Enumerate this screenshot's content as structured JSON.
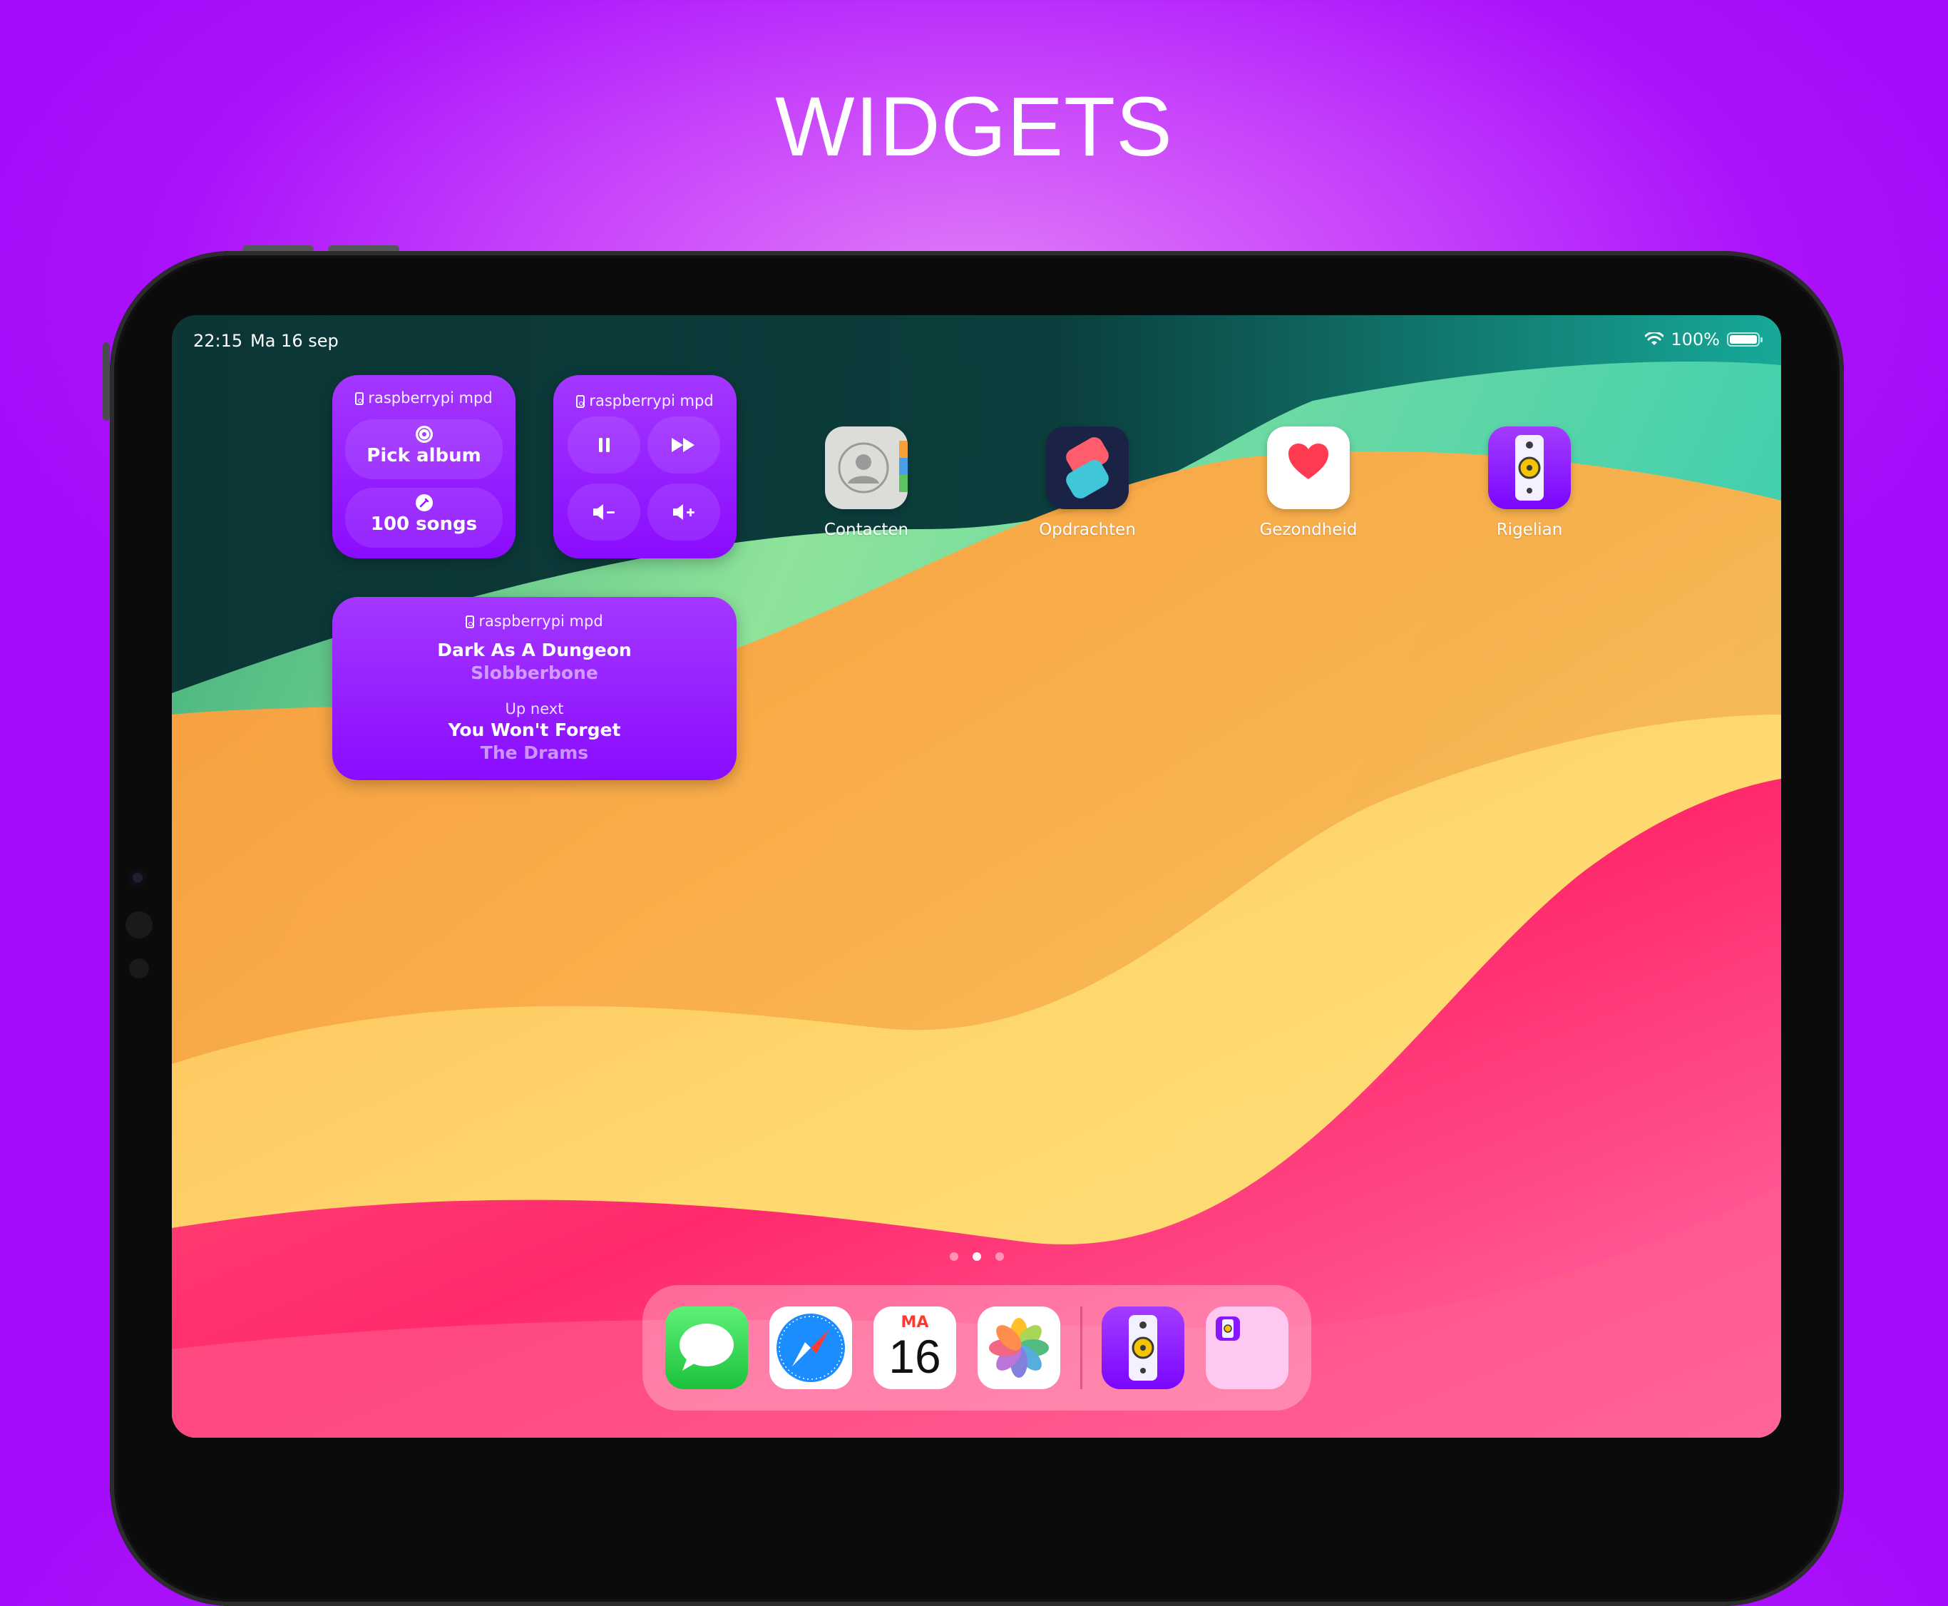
{
  "headline": "WIDGETS",
  "status_bar": {
    "time": "22:15",
    "date": "Ma 16 sep",
    "battery": "100%"
  },
  "widget_small_pick": {
    "title": "raspberrypi mpd",
    "pick_album_label": "Pick album",
    "songs_label": "100 songs"
  },
  "widget_small_controls": {
    "title": "raspberrypi mpd",
    "controls": [
      "pause-icon",
      "fast-forward-icon",
      "volume-down-icon",
      "volume-up-icon"
    ]
  },
  "widget_now_playing": {
    "title": "raspberrypi mpd",
    "current_song": "Dark As A Dungeon",
    "current_artist": "Slobberbone",
    "up_next_label": "Up next",
    "next_song": "You Won't Forget",
    "next_artist": "The Drams"
  },
  "apps": [
    {
      "name": "Contacten",
      "icon": "contacts-icon"
    },
    {
      "name": "Opdrachten",
      "icon": "shortcuts-icon"
    },
    {
      "name": "Gezondheid",
      "icon": "health-icon"
    },
    {
      "name": "Rigelian",
      "icon": "speaker-icon"
    }
  ],
  "page_dots": {
    "count": 3,
    "active": 1
  },
  "dock": {
    "apps": [
      "messages-icon",
      "safari-icon",
      "calendar-icon",
      "photos-icon",
      "rigelian-icon",
      "app-library-icon"
    ],
    "calendar_day": "MA",
    "calendar_date": "16"
  },
  "colors": {
    "background": "#b21cfb",
    "widget": "#9b22ff",
    "accent_yellow": "#f5c400"
  }
}
